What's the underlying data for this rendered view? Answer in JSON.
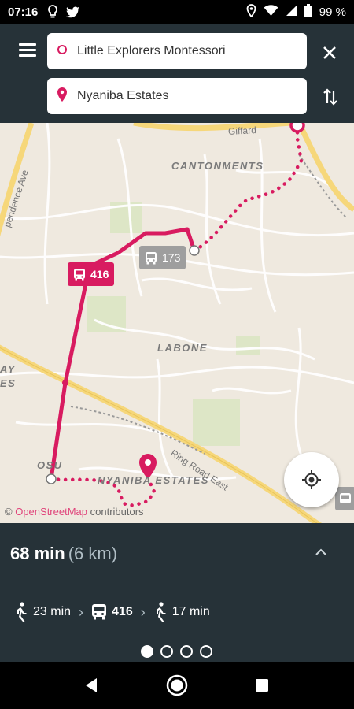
{
  "status_bar": {
    "time": "07:16",
    "battery": "99 %",
    "icons": [
      "lightbulb-icon",
      "twitter-icon",
      "location-icon",
      "wifi-icon",
      "signal-icon",
      "battery-icon"
    ]
  },
  "search": {
    "from": "Little Explorers Montessori",
    "to": "Nyaniba Estates"
  },
  "map": {
    "area_labels": [
      "CANTONMENTS",
      "LABONE",
      "NYANIBA ESTATES"
    ],
    "partial_labels": [
      "OSU",
      "AY",
      "ES"
    ],
    "road_labels": [
      "Ring Road East",
      "pendence Ave",
      "Giffard"
    ],
    "bus_route": "416",
    "other_bus": "173",
    "attribution_prefix": "©",
    "attribution_link": "OpenStreetMap",
    "attribution_suffix": "contributors",
    "route_color": "#d81b60"
  },
  "trip": {
    "duration": "68 min",
    "distance": "(6 km)",
    "walk1": "23 min",
    "bus": "416",
    "walk2": "17 min"
  },
  "pager": {
    "count": 4,
    "active": 0
  }
}
